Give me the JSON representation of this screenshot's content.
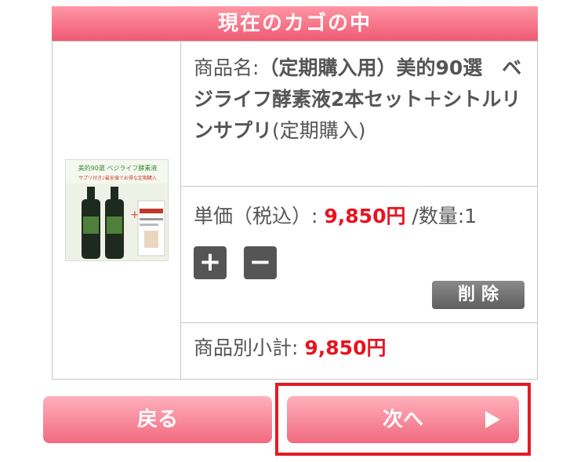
{
  "cart": {
    "header": "現在のカゴの中",
    "item": {
      "name_label": "商品名:",
      "name": "（定期購入用）美的90選　ベジライフ酵素液2本セット＋シトルリンサプリ",
      "name_suffix": "(定期購入)",
      "price_label": "単価（税込）:",
      "price": "9,850円",
      "quantity_text": "/数量:1",
      "plus_label": "+",
      "minus_label": "−",
      "delete_label": "削除",
      "subtotal_label": "商品別小計:",
      "subtotal": "9,850円"
    },
    "product_image_text": {
      "line1": "美的90選 ベジライフ酵素液",
      "line2": "サプリ付き♪最安値でお得な定期購入"
    }
  },
  "nav": {
    "back_label": "戻る",
    "next_label": "次へ"
  },
  "colors": {
    "accent": "#ef5a72",
    "price_red": "#e8131f",
    "highlight_red": "#e31b23"
  }
}
